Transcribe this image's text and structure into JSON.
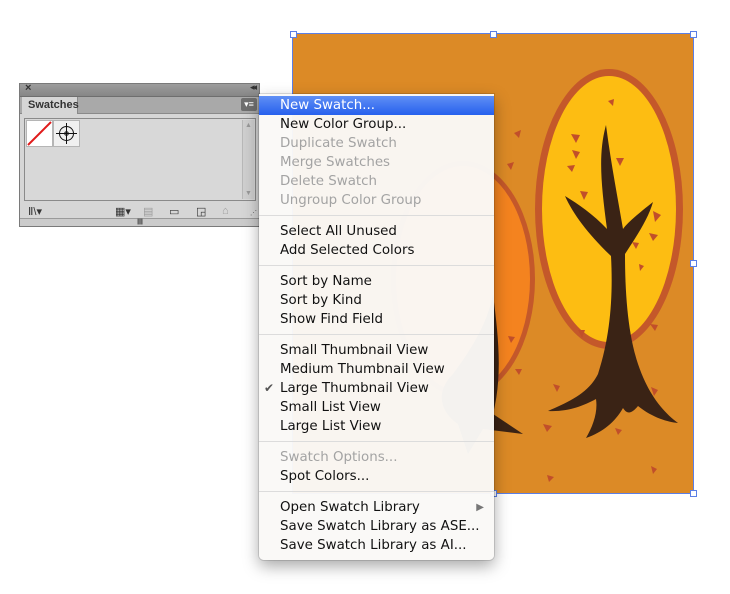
{
  "artboard": {
    "background": "#DC8A26",
    "selection_color": "#5B7FE6"
  },
  "panel": {
    "close_icon": "close-icon",
    "collapse_icon": "collapse-icon",
    "tab_label": "Swatches",
    "menu_button_icon": "panel-menu-icon",
    "swatches": [
      {
        "name": "None",
        "type": "none-swatch"
      },
      {
        "name": "Registration",
        "type": "registration-swatch"
      }
    ],
    "footer_icons": [
      {
        "name": "swatch-libraries-menu",
        "glyph": "⫼",
        "enabled": true
      },
      {
        "name": "show-swatch-kinds-menu",
        "glyph": "▦",
        "enabled": true
      },
      {
        "name": "swatch-options",
        "glyph": "▤",
        "enabled": false
      },
      {
        "name": "new-color-group",
        "glyph": "▭",
        "enabled": true
      },
      {
        "name": "new-swatch",
        "glyph": "◲",
        "enabled": true
      },
      {
        "name": "delete-swatch",
        "glyph": "🗑",
        "enabled": false
      }
    ]
  },
  "menu": {
    "groups": [
      [
        {
          "label": "New Swatch...",
          "enabled": true,
          "highlighted": true
        },
        {
          "label": "New Color Group...",
          "enabled": true
        },
        {
          "label": "Duplicate Swatch",
          "enabled": false
        },
        {
          "label": "Merge Swatches",
          "enabled": false
        },
        {
          "label": "Delete Swatch",
          "enabled": false
        },
        {
          "label": "Ungroup Color Group",
          "enabled": false
        }
      ],
      [
        {
          "label": "Select All Unused",
          "enabled": true
        },
        {
          "label": "Add Selected Colors",
          "enabled": true
        }
      ],
      [
        {
          "label": "Sort by Name",
          "enabled": true
        },
        {
          "label": "Sort by Kind",
          "enabled": true
        },
        {
          "label": "Show Find Field",
          "enabled": true
        }
      ],
      [
        {
          "label": "Small Thumbnail View",
          "enabled": true
        },
        {
          "label": "Medium Thumbnail View",
          "enabled": true
        },
        {
          "label": "Large Thumbnail View",
          "enabled": true,
          "checked": true
        },
        {
          "label": "Small List View",
          "enabled": true
        },
        {
          "label": "Large List View",
          "enabled": true
        }
      ],
      [
        {
          "label": "Swatch Options...",
          "enabled": false
        },
        {
          "label": "Spot Colors...",
          "enabled": true
        }
      ],
      [
        {
          "label": "Open Swatch Library",
          "enabled": true,
          "submenu": true
        },
        {
          "label": "Save Swatch Library as ASE...",
          "enabled": true
        },
        {
          "label": "Save Swatch Library as AI...",
          "enabled": true
        }
      ]
    ],
    "check_glyph": "✔",
    "submenu_glyph": "▶"
  }
}
